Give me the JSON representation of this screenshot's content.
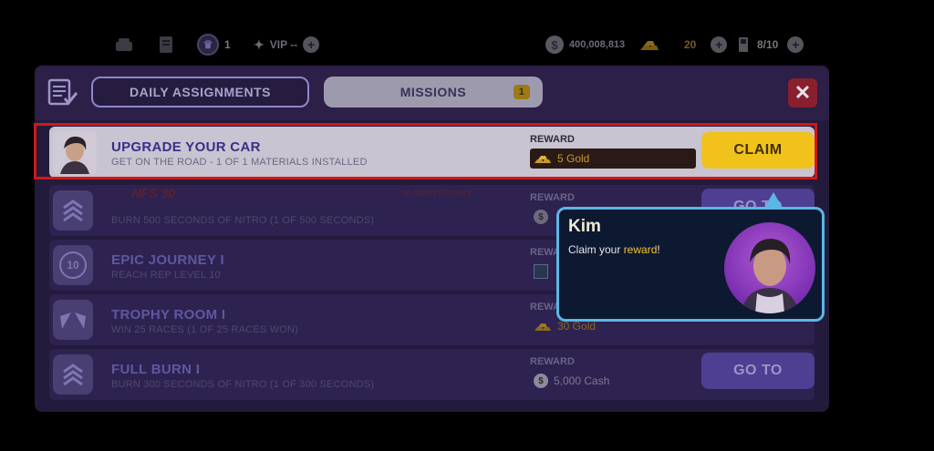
{
  "topbar": {
    "crown_count": "1",
    "vip_label": "VIP --",
    "cash_symbol": "$",
    "cash": "400,008,813",
    "gold": "20",
    "fuel": "8/10",
    "plus": "+"
  },
  "tabs": {
    "daily": "DAILY ASSIGNMENTS",
    "missions": "MISSIONS",
    "missions_badge": "1"
  },
  "close_label": "✕",
  "reward_label": "REWARD",
  "missions": [
    {
      "title": "UPGRADE YOUR CAR",
      "desc": "GET ON THE ROAD - 1 OF 1 MATERIALS INSTALLED",
      "reward": "5 Gold",
      "action": "CLAIM"
    },
    {
      "title": "",
      "desc": "BURN 500 SECONDS OF NITRO (1 OF 500 SECONDS)",
      "reward": "",
      "action": "GO TO"
    },
    {
      "title": "EPIC JOURNEY I",
      "desc": "REACH REP LEVEL 10",
      "icon_text": "10",
      "reward": "",
      "action": ""
    },
    {
      "title": "TROPHY ROOM I",
      "desc": "WIN 25 RACES (1 OF 25 RACES WON)",
      "reward": "30 Gold",
      "action": ""
    },
    {
      "title": "FULL BURN I",
      "desc": "BURN 300 SECONDS OF NITRO (1 OF 300 SECONDS)",
      "reward": "5,000 Cash",
      "action": "GO TO"
    }
  ],
  "logos": {
    "nfs": "NFS 30",
    "anniversary": "30 ANNIVERSARY"
  },
  "bubble": {
    "speaker": "Kim",
    "msg_before": "Claim your ",
    "msg_highlight": "reward",
    "msg_after": "!"
  },
  "colors": {
    "panel": "#241a3b",
    "claim": "#f1c21c",
    "highlight_border": "#d01818",
    "bubble_border": "#5bb7e6"
  }
}
